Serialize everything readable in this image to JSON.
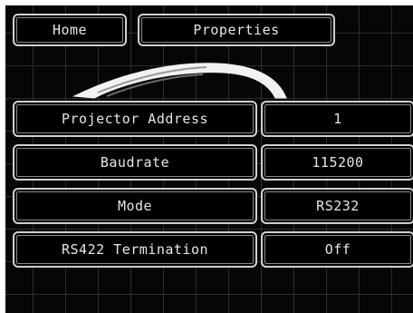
{
  "header": {
    "tabs": [
      {
        "label": "Home"
      },
      {
        "label": "Properties"
      }
    ]
  },
  "properties": [
    {
      "label": "Projector Address",
      "value": "1"
    },
    {
      "label": "Baudrate",
      "value": "115200"
    },
    {
      "label": "Mode",
      "value": "RS232"
    },
    {
      "label": "RS422 Termination",
      "value": "Off"
    }
  ],
  "colors": {
    "background": "#060606",
    "grid": "#2c2c2c",
    "button_border": "#cfcfcf",
    "text": "#e6e6e6"
  },
  "icons": {
    "logo": "swoosh-logo-icon"
  }
}
